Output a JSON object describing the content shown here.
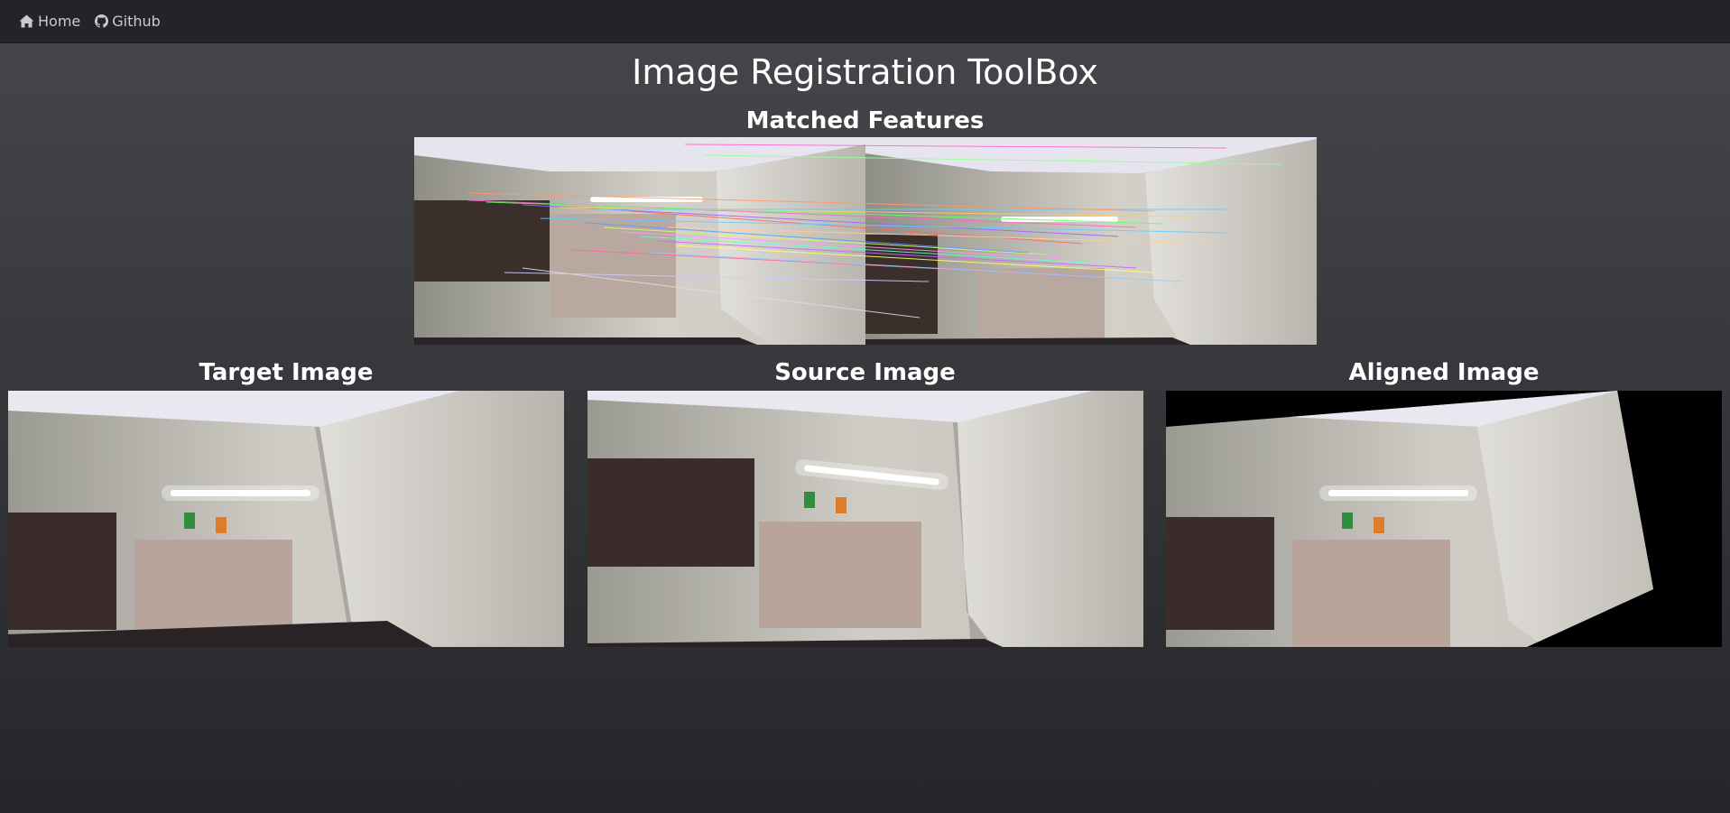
{
  "nav": {
    "home_label": "Home",
    "github_label": "Github"
  },
  "page": {
    "title": "Image Registration ToolBox"
  },
  "matched": {
    "title": "Matched Features"
  },
  "panels": [
    {
      "title": "Target Image"
    },
    {
      "title": "Source Image"
    },
    {
      "title": "Aligned Image"
    }
  ],
  "colors": {
    "navbar_bg": "#222428",
    "nav_text": "#c9cbce",
    "page_bg_top": "#45474b",
    "page_bg_bottom": "#24262a",
    "title_text": "#ffffff"
  },
  "icons": {
    "home": "home-icon",
    "github": "github-icon"
  }
}
